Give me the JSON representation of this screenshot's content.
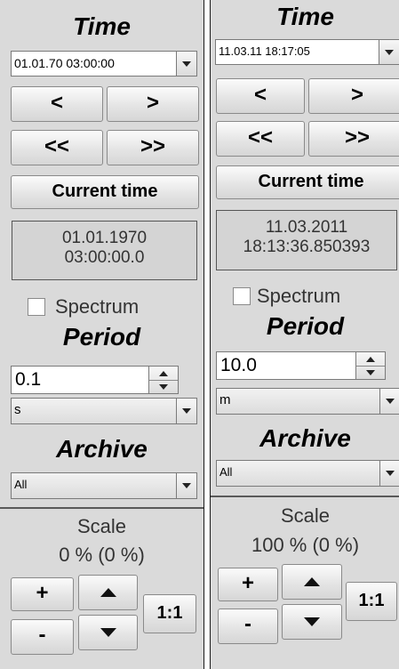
{
  "panels": [
    {
      "time_heading": "Time",
      "datetime_value": "01.01.70 03:00:00",
      "prev_label": "<",
      "next_label": ">",
      "fast_prev_label": "<<",
      "fast_next_label": ">>",
      "current_time_label": "Current time",
      "readout_line1": "01.01.1970",
      "readout_line2": "03:00:00.0",
      "spectrum_label": "Spectrum",
      "spectrum_checked": false,
      "period_heading": "Period",
      "period_value": "0.1",
      "period_unit": "s",
      "archive_heading": "Archive",
      "archive_value": "All",
      "scale_label": "Scale",
      "scale_value": "0 % (0 %)",
      "plus_label": "+",
      "minus_label": "-",
      "one_to_one_label": "1:1"
    },
    {
      "time_heading": "Time",
      "datetime_value": "11.03.11 18:17:05",
      "prev_label": "<",
      "next_label": ">",
      "fast_prev_label": "<<",
      "fast_next_label": ">>",
      "current_time_label": "Current time",
      "readout_line1": "11.03.2011",
      "readout_line2": "18:13:36.850393",
      "spectrum_label": "Spectrum",
      "spectrum_checked": false,
      "period_heading": "Period",
      "period_value": "10.0",
      "period_unit": "m",
      "archive_heading": "Archive",
      "archive_value": "All",
      "scale_label": "Scale",
      "scale_value": "100 % (0 %)",
      "plus_label": "+",
      "minus_label": "-",
      "one_to_one_label": "1:1"
    }
  ],
  "colors": {
    "panel_background": "#dadada",
    "readout_background": "#d4d4d4",
    "divider": "#5a5a5a"
  }
}
